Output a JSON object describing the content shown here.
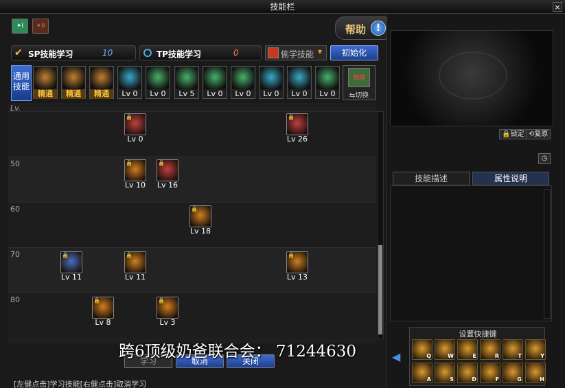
{
  "window": {
    "title": "技能栏",
    "close": "×"
  },
  "tabs": [
    {
      "label": "I"
    },
    {
      "label": "II"
    }
  ],
  "help": {
    "label": "帮助",
    "icon": "!"
  },
  "sp": {
    "label": "SP技能学习",
    "value": "10"
  },
  "tp": {
    "label": "TP技能学习",
    "value": "0"
  },
  "steal": {
    "label": "偷学技能"
  },
  "init_button": "初始化",
  "common_label": "通用技能",
  "common_skills": [
    {
      "name": "skill-common-1",
      "level": "精通",
      "pro": true,
      "color": "#c08030"
    },
    {
      "name": "skill-common-2",
      "level": "精通",
      "pro": true,
      "color": "#c08030"
    },
    {
      "name": "skill-common-3",
      "level": "精通",
      "pro": true,
      "color": "#c08030"
    },
    {
      "name": "skill-common-4",
      "level": "Lv 0",
      "pro": false,
      "color": "#3aa9c9"
    },
    {
      "name": "skill-common-5",
      "level": "Lv 0",
      "pro": false,
      "color": "#4ab06a"
    },
    {
      "name": "skill-common-6",
      "level": "Lv 5",
      "pro": false,
      "color": "#4ab06a"
    },
    {
      "name": "skill-common-7",
      "level": "Lv 0",
      "pro": false,
      "color": "#4ab06a"
    },
    {
      "name": "skill-common-8",
      "level": "Lv 0",
      "pro": false,
      "color": "#4ab06a"
    },
    {
      "name": "skill-common-9",
      "level": "Lv 0",
      "pro": false,
      "color": "#3aa9c9"
    },
    {
      "name": "skill-common-10",
      "level": "Lv 0",
      "pro": false,
      "color": "#3aa9c9"
    },
    {
      "name": "skill-common-11",
      "level": "Lv 0",
      "pro": false,
      "color": "#4ab06a"
    }
  ],
  "swap": {
    "label": "切换",
    "tag": "物理"
  },
  "tree": {
    "header": "Lv.",
    "rows": [
      {
        "label": ""
      },
      {
        "label": "50"
      },
      {
        "label": "60"
      },
      {
        "label": "70"
      },
      {
        "label": "80"
      }
    ],
    "nodes": [
      {
        "level": "Lv 0",
        "color": "#c04040"
      },
      {
        "level": "Lv 26",
        "color": "#c04040"
      },
      {
        "level": "Lv 10",
        "color": "#d08020"
      },
      {
        "level": "Lv 16",
        "color": "#c04040"
      },
      {
        "level": "Lv 18",
        "color": "#d08020"
      },
      {
        "level": "Lv 11",
        "color": "#4a70c0"
      },
      {
        "level": "Lv 11",
        "color": "#d08020"
      },
      {
        "level": "Lv 13",
        "color": "#d08020"
      },
      {
        "level": "Lv 8",
        "color": "#d08020"
      },
      {
        "level": "Lv 3",
        "color": "#d08020"
      }
    ]
  },
  "buttons": {
    "learn": "学习",
    "cancel": "取消",
    "close": "关闭"
  },
  "footer": "[左健点击]学习技能[右健点击]取消学习",
  "overlay": "跨6顶级奶爸联合会：  71244630",
  "preview": {
    "lock": "锁定",
    "reset": "复原"
  },
  "desc_tabs": [
    {
      "label": "技能描述"
    },
    {
      "label": "属性说明"
    }
  ],
  "quick": {
    "title": "设置快捷键",
    "slots": [
      "Q",
      "W",
      "E",
      "R",
      "T",
      "Y",
      "A",
      "S",
      "D",
      "F",
      "G",
      "H"
    ]
  }
}
